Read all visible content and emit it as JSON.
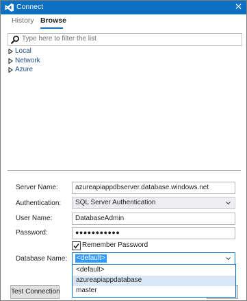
{
  "window": {
    "title": "Connect",
    "close_glyph": "✕"
  },
  "tabs": [
    {
      "label": "History",
      "active": false
    },
    {
      "label": "Browse",
      "active": true
    }
  ],
  "filter": {
    "placeholder": "Type here to filter the list"
  },
  "tree": {
    "items": [
      {
        "label": "Local",
        "expanded": false
      },
      {
        "label": "Network",
        "expanded": false
      },
      {
        "label": "Azure",
        "expanded": false
      }
    ]
  },
  "form": {
    "server_name": {
      "label": "Server Name:",
      "value": "azureapiappdbserver.database.windows.net"
    },
    "authentication": {
      "label": "Authentication:",
      "value": "SQL Server Authentication"
    },
    "user_name": {
      "label": "User Name:",
      "value": "DatabaseAdmin"
    },
    "password": {
      "label": "Password:",
      "value": "●●●●●●●●●●●"
    },
    "remember_password": {
      "label": "Remember Password",
      "checked": true
    },
    "database_name": {
      "label": "Database Name:",
      "value": "<default>"
    },
    "database_options": [
      "<default>",
      "azureapiappdatabase",
      "master"
    ]
  },
  "buttons": {
    "test_connection": "Test Connection"
  },
  "icons": {
    "app": "visual-studio-icon",
    "search": "search-icon",
    "expand": "triangle-right-icon",
    "dropdown": "chevron-down-icon",
    "check": "checkmark-icon",
    "close": "close-icon"
  },
  "colors": {
    "titlebar": "#0e70c0",
    "accent": "#0e70c0",
    "selection": "#3399ff",
    "hover": "#d8e6f5",
    "link": "#1e4c8c"
  }
}
